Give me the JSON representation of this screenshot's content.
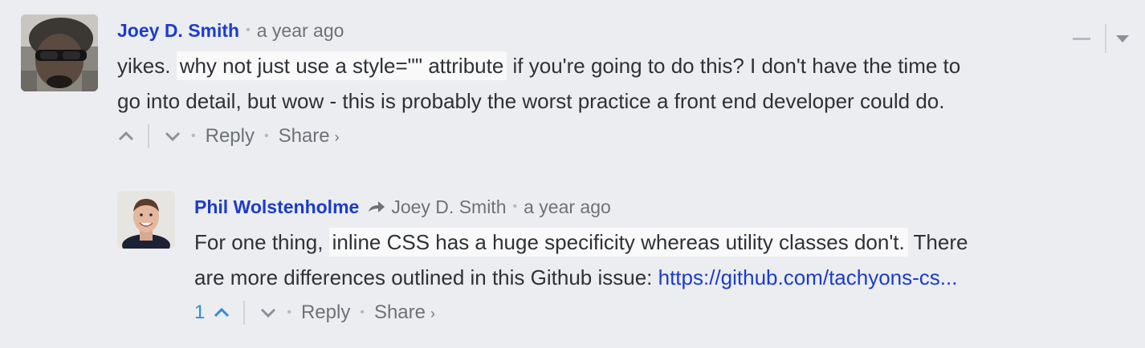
{
  "comments": [
    {
      "author": "Joey D. Smith",
      "time": "a year ago",
      "text_before": "yikes. ",
      "text_highlight": "why not just use a style=\"\" attribute",
      "text_after_line1": " if you're going to do this? I don't have the time to",
      "text_line2": "go into detail, but wow - this is probably the worst practice a front end developer could do.",
      "reply_label": "Reply",
      "share_label": "Share",
      "share_chevron": "›",
      "upvote_icon": "chevron-up-icon",
      "downvote_icon": "chevron-down-icon"
    },
    {
      "author": "Phil Wolstenholme",
      "reply_to": "Joey D. Smith",
      "time": "a year ago",
      "text_before": "For one thing, ",
      "text_highlight": "inline CSS has a huge specificity whereas utility classes don't.",
      "text_after_line1": " There",
      "text_line2": "are more differences outlined in this Github issue: ",
      "link": "https://github.com/tachyons-cs...",
      "upvotes": "1",
      "reply_label": "Reply",
      "share_label": "Share",
      "share_chevron": "›",
      "upvote_icon": "chevron-up-icon",
      "downvote_icon": "chevron-down-icon",
      "reply_arrow_icon": "reply-arrow-icon"
    }
  ],
  "colors": {
    "background": "#ecedf0",
    "author": "#1b3ccc",
    "link": "#1b3ccc",
    "upvote_active": "#2d8be0",
    "muted": "#6e7276"
  }
}
